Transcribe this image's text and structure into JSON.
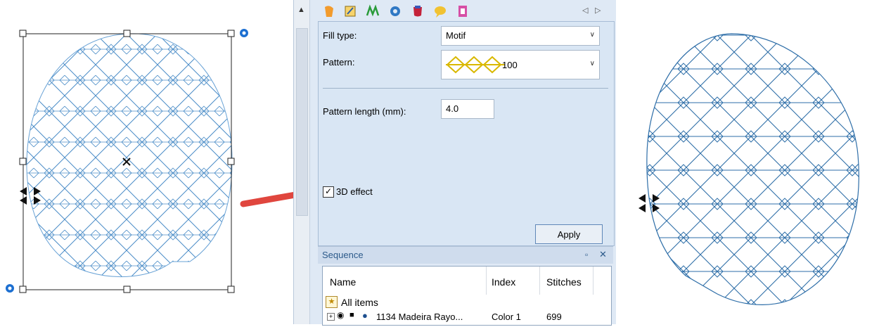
{
  "panel": {
    "tabs": [
      "shape-tab-icon",
      "edit-tab-icon",
      "effects-tab-icon",
      "settings-tab-icon",
      "color-tab-icon",
      "comment-tab-icon",
      "thread-tab-icon"
    ],
    "fill_type_label": "Fill type:",
    "fill_type_value": "Motif",
    "pattern_label": "Pattern:",
    "pattern_value": "100",
    "pattern_length_label": "Pattern length (mm):",
    "pattern_length_value": "4.0",
    "effect_label": "3D effect",
    "effect_checked": "✓",
    "apply_label": "Apply"
  },
  "sequence": {
    "title": "Sequence",
    "pin_icon": "pin-icon",
    "close_icon": "close-icon",
    "columns": [
      "Name",
      "Index",
      "Stitches"
    ],
    "rows": [
      {
        "name": "All items",
        "index": "",
        "stitches": ""
      },
      {
        "name": "1134 Madeira Rayo...",
        "index": "Color 1",
        "stitches": "699"
      }
    ]
  },
  "colors": {
    "accent_arrow": "#e0463e",
    "stitch_blue": "#3a7ab8",
    "panel_bg": "#dfe9f5"
  }
}
